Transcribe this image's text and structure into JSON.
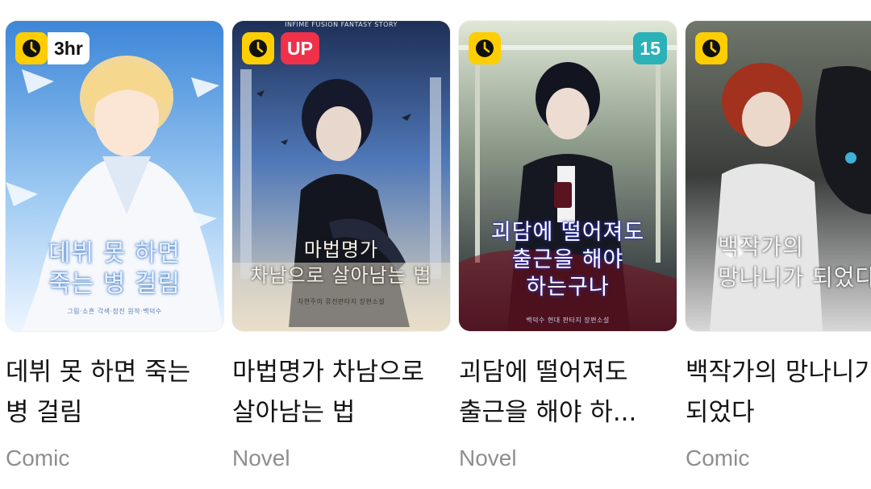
{
  "cards": [
    {
      "cover_title": "데뷔 못 하면\n죽는 병 걸림",
      "credits": "그림·소흔   각색·장진   원작·백덕수",
      "clock_icon": "clock-icon",
      "badge": "3hr",
      "badge_type": "time",
      "title": "데뷔 못 하면 죽는 병 걸림",
      "genre": "Comic"
    },
    {
      "cover_top": "INFIME FUSION FANTASY STORY",
      "cover_title": "마법명가\n차남으로 살아남는 법",
      "credits": "차현주의 퓨전판타지 장편소설",
      "clock_icon": "clock-icon",
      "badge": "UP",
      "badge_type": "up",
      "title": "마법명가 차남으로 살아남는 법",
      "genre": "Novel"
    },
    {
      "cover_title": "괴담에 떨어져도\n출근을 해야\n하는구나",
      "credits": "백덕수   현대 판타지 장편소설",
      "clock_icon": "clock-icon",
      "badge": "15",
      "badge_type": "age",
      "title": "괴담에 떨어져도 출근을 해야 하...",
      "genre": "Novel"
    },
    {
      "cover_title": "백작가의\n망나니가 되었다",
      "clock_icon": "clock-icon",
      "title": "백작가의 망나니가 되었다",
      "genre": "Comic"
    }
  ],
  "colors": {
    "clock_badge": "#ffce00",
    "up_badge": "#f0314a",
    "age_badge": "#2bb1b8",
    "title_text": "#141414",
    "genre_text": "#8e8e8e"
  }
}
